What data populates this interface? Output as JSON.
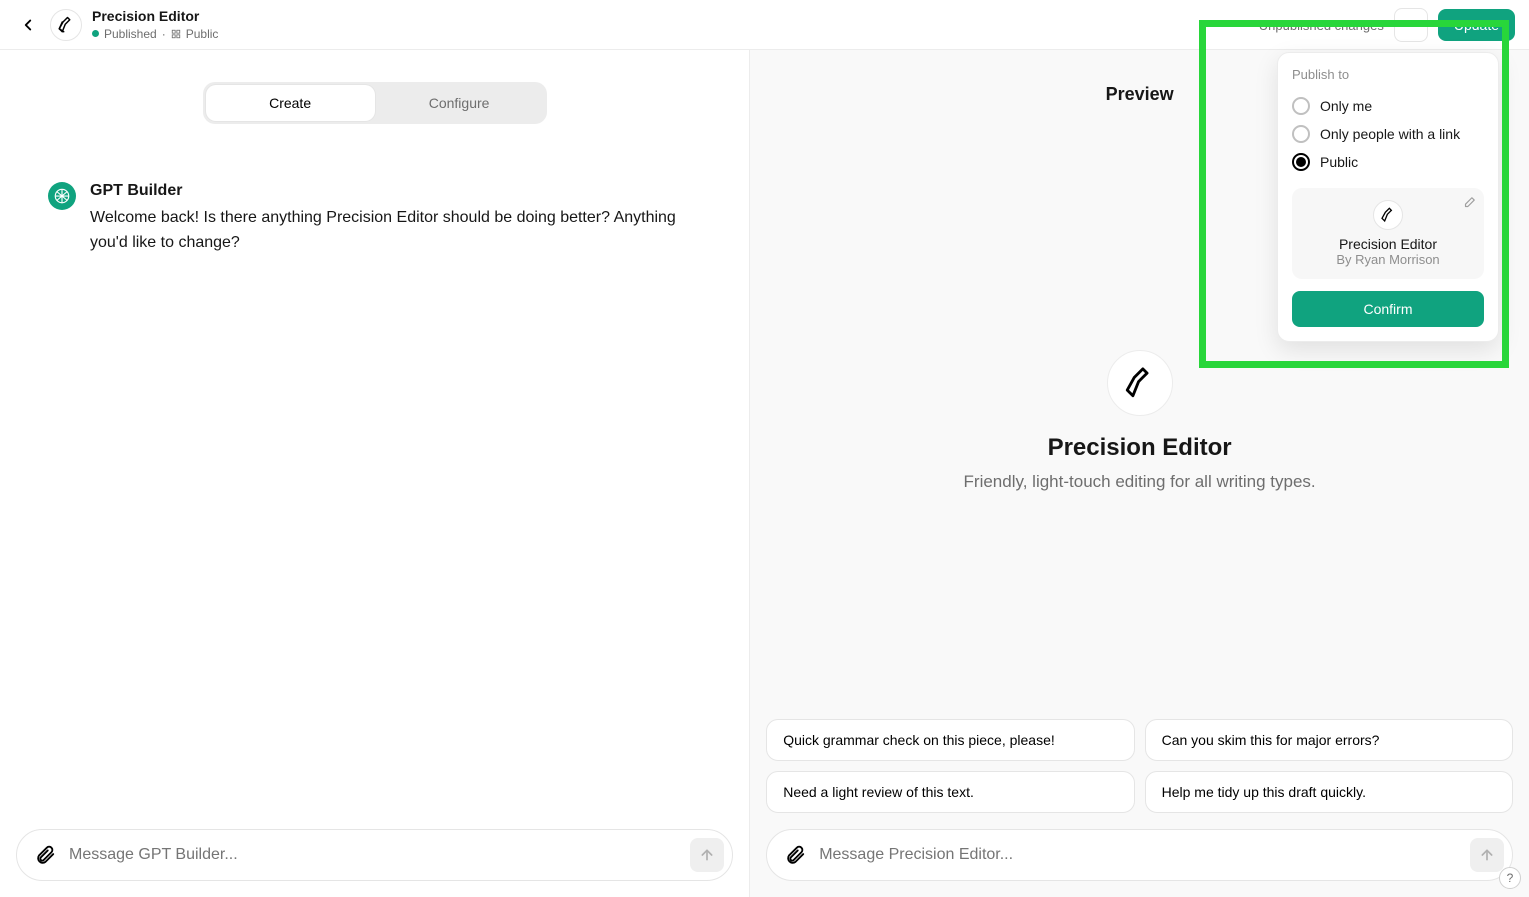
{
  "header": {
    "title": "Precision Editor",
    "status_published": "Published",
    "visibility": "Public",
    "unpublished_changes": "Unpublished changes",
    "update_button": "Update"
  },
  "tabs": {
    "create": "Create",
    "configure": "Configure",
    "active": "create"
  },
  "builder": {
    "name": "GPT Builder",
    "message": "Welcome back! Is there anything Precision Editor should be doing better? Anything you'd like to change?"
  },
  "left_input": {
    "placeholder": "Message GPT Builder..."
  },
  "preview": {
    "heading": "Preview",
    "gpt_name": "Precision Editor",
    "gpt_desc": "Friendly, light-touch editing for all writing types."
  },
  "suggestions": [
    "Quick grammar check on this piece, please!",
    "Can you skim this for major errors?",
    "Need a light review of this text.",
    "Help me tidy up this draft quickly."
  ],
  "right_input": {
    "placeholder": "Message Precision Editor..."
  },
  "publish": {
    "title": "Publish to",
    "options": {
      "only_me": "Only me",
      "link": "Only people with a link",
      "public": "Public"
    },
    "selected": "public",
    "card_name": "Precision Editor",
    "card_author": "By Ryan Morrison",
    "confirm": "Confirm"
  },
  "help_label": "?"
}
